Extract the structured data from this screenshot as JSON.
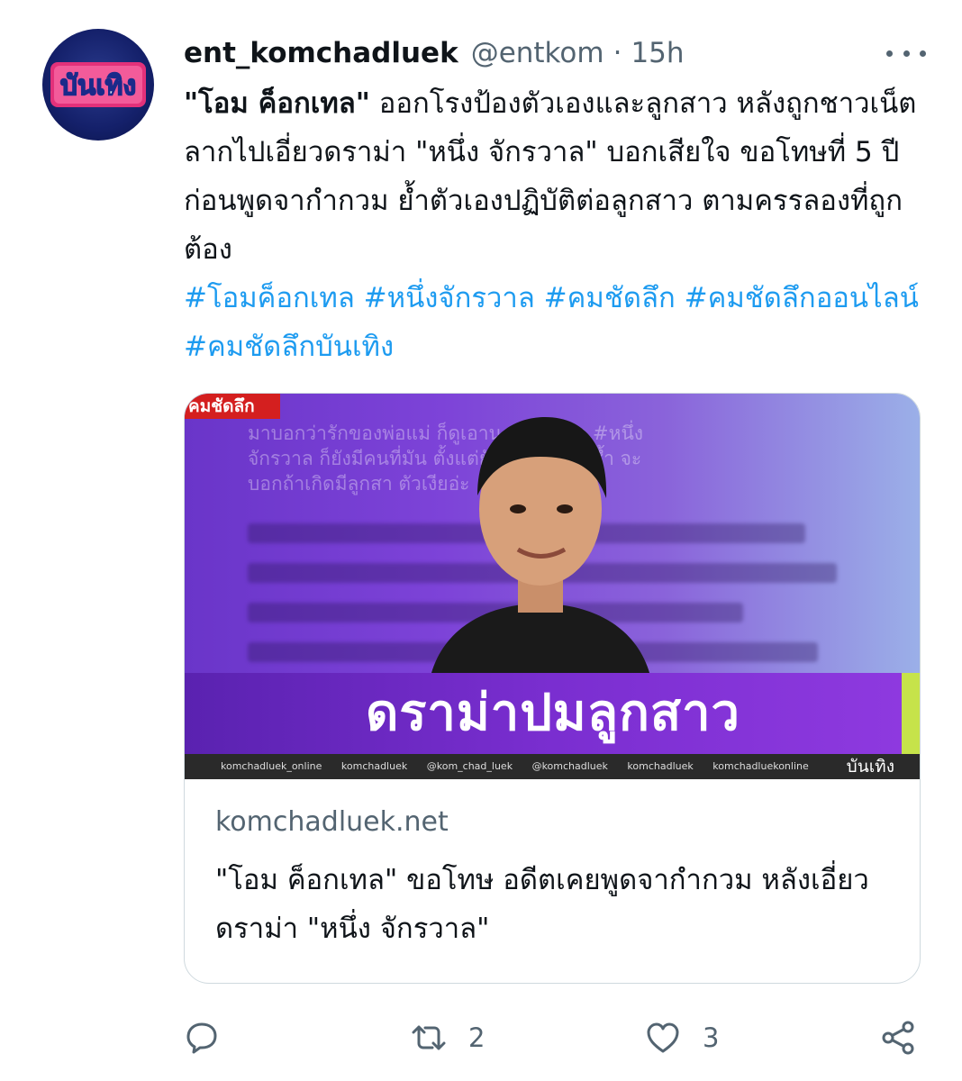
{
  "tweet": {
    "display_name": "ent_komchadluek",
    "handle": "@entkom",
    "separator": "·",
    "time": "15h",
    "avatar_text": "บันเทิง",
    "text_bold": "\"โอม ค็อกเทล\"",
    "text_body": " ออกโรงป้องตัวเองและลูกสาว หลังถูกชาวเน็ตลากไปเอี่ยวดราม่า \"หนึ่ง จักรวาล\" บอกเสียใจ ขอโทษที่ 5 ปีก่อนพูดจากำกวม ย้ำตัวเองปฏิบัติต่อลูกสาว ตามครรลองที่ถูกต้อง",
    "hashtags": "#โอมค็อกเทล #หนึ่งจักรวาล #คมชัดลึก #คมชัดลึกออนไลน์ #คมชัดลึกบันเทิง"
  },
  "card": {
    "brand": "คมชัดลึก",
    "blurred_line_1": "มาบอกว่ารักของพ่อแม่ ก็ดูเอานะ นอกจาก #หนึ่ง",
    "blurred_line_2": "จักรวาล ก็ยังมีคนที่มัน ตั้งแต่ยังไม่มีลูกด้วยซ้ำ จะ",
    "blurred_line_3": "บอกถ้าเกิดมีลูกสา ตัวเงียอ่ะ",
    "banner_title": "ดราม่าปมลูกสาว",
    "social_items": [
      "komchadluek_online",
      "komchadluek",
      "@kom_chad_luek",
      "@komchadluek",
      "komchadluek",
      "komchadluekonline"
    ],
    "section_tag": "บันเทิง",
    "domain": "komchadluek.net",
    "title": "\"โอม ค็อกเทล\" ขอโทษ อดีตเคยพูดจากำกวม หลังเอี่ยวดราม่า \"หนึ่ง จักรวาล\""
  },
  "actions": {
    "reply_count": "",
    "retweet_count": "2",
    "like_count": "3"
  },
  "colors": {
    "link": "#1d9bf0",
    "secondary_text": "#536471",
    "banner_purple": "#7a2ed0",
    "accent_green": "#c6e34a"
  },
  "icons": [
    "more-icon",
    "reply-icon",
    "retweet-icon",
    "like-icon",
    "share-icon"
  ]
}
